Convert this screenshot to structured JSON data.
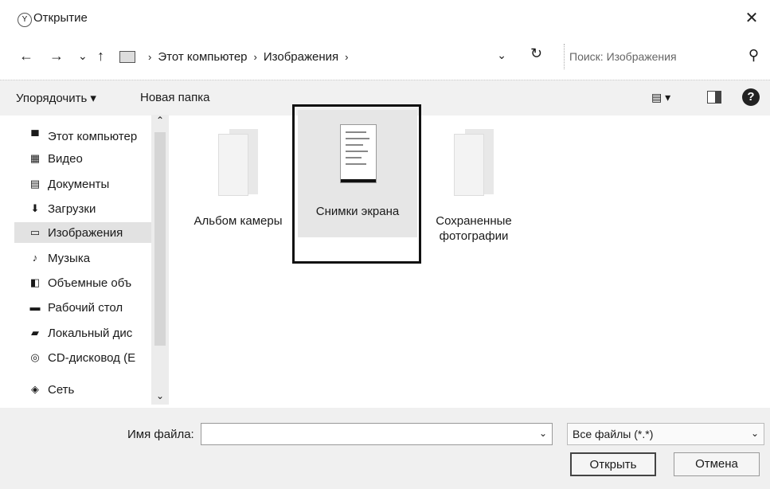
{
  "window": {
    "title": "Открытие",
    "close_glyph": "✕",
    "app_icon": "Y"
  },
  "nav": {
    "back": "←",
    "forward": "→",
    "recent": "⌄",
    "up": "↑",
    "address": [
      "Этот компьютер",
      "Изображения"
    ],
    "separator": "›",
    "dropdown": "⌄",
    "refresh": "↻",
    "search_placeholder": "Поиск: Изображения",
    "search_icon": "⚲"
  },
  "toolbar": {
    "organize": "Упорядочить ▾",
    "new_folder": "Новая папка",
    "view_glyph": "▤ ▾",
    "help": "?"
  },
  "sidebar": {
    "items": [
      {
        "label": "Этот компьютер",
        "icon": "computer-icon",
        "glyph": "▀"
      },
      {
        "label": "Видео",
        "icon": "video-icon",
        "glyph": "▦"
      },
      {
        "label": "Документы",
        "icon": "documents-icon",
        "glyph": "▤"
      },
      {
        "label": "Загрузки",
        "icon": "downloads-icon",
        "glyph": "⬇"
      },
      {
        "label": "Изображения",
        "icon": "pictures-icon",
        "glyph": "▭"
      },
      {
        "label": "Музыка",
        "icon": "music-icon",
        "glyph": "♪"
      },
      {
        "label": "Объемные объ",
        "icon": "3d-objects-icon",
        "glyph": "◧"
      },
      {
        "label": "Рабочий стол",
        "icon": "desktop-icon",
        "glyph": "▬"
      },
      {
        "label": "Локальный дис",
        "icon": "local-disk-icon",
        "glyph": "▰"
      },
      {
        "label": "CD-дисковод (E",
        "icon": "cd-drive-icon",
        "glyph": "◎"
      },
      {
        "label": "Сеть",
        "icon": "network-icon",
        "glyph": "◈"
      }
    ],
    "selected_index": 4,
    "scroll_up": "⌃",
    "scroll_down": "⌄"
  },
  "folders": [
    {
      "label": "Альбом камеры",
      "selected": false
    },
    {
      "label": "Снимки экрана",
      "selected": true
    },
    {
      "label": "Сохраненные фотографии",
      "selected": false
    }
  ],
  "bottom": {
    "filename_label": "Имя файла:",
    "filename_value": "",
    "filename_dropdown": "⌄",
    "filter_value": "Все файлы (*.*)",
    "filter_dropdown": "⌄",
    "open_label": "Открыть",
    "cancel_label": "Отмена"
  }
}
